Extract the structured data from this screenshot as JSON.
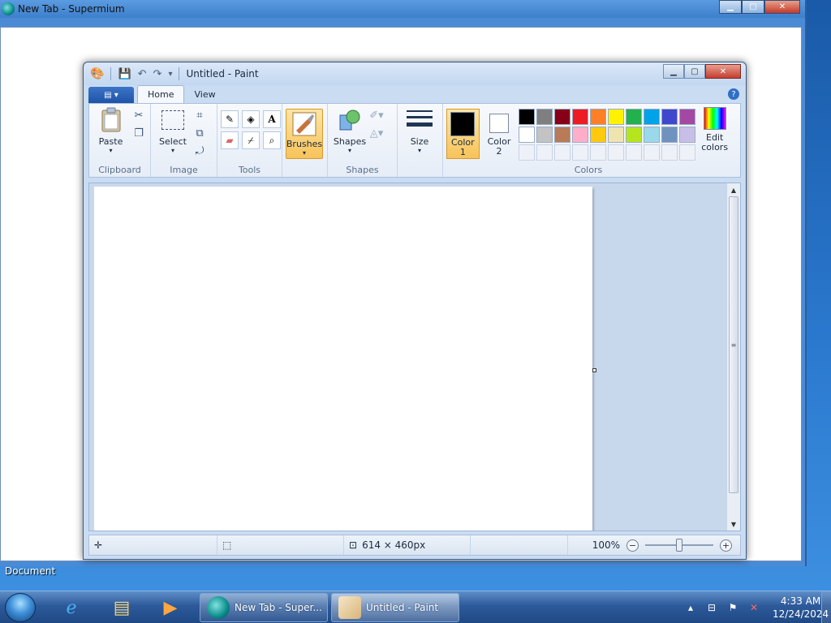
{
  "browser": {
    "title": "New Tab - Supermium"
  },
  "paint": {
    "title": "Untitled - Paint",
    "tabs": [
      {
        "label": "Home",
        "active": true
      },
      {
        "label": "View",
        "active": false
      }
    ],
    "groups": {
      "clipboard": {
        "label": "Clipboard",
        "paste": "Paste"
      },
      "image": {
        "label": "Image",
        "select": "Select"
      },
      "tools": {
        "label": "Tools"
      },
      "brushes": {
        "label": "Brushes"
      },
      "shapes": {
        "label": "Shapes",
        "shapes": "Shapes"
      },
      "size": {
        "label": "Size"
      },
      "colors": {
        "label": "Colors",
        "color1": "Color\n1",
        "color2": "Color\n2",
        "edit": "Edit colors",
        "color1_value": "#000000",
        "color2_value": "#ffffff",
        "palette": [
          "#000000",
          "#7f7f7f",
          "#880015",
          "#ed1c24",
          "#ff7f27",
          "#fff200",
          "#22b14c",
          "#00a2e8",
          "#3f48cc",
          "#a349a4",
          "#ffffff",
          "#c3c3c3",
          "#b97a57",
          "#ffaec9",
          "#ffc90e",
          "#efe4b0",
          "#b5e61d",
          "#99d9ea",
          "#7092be",
          "#c8bfe7",
          "",
          "",
          "",
          "",
          "",
          "",
          "",
          "",
          "",
          ""
        ]
      }
    },
    "status": {
      "canvas_size": "614 × 460px",
      "zoom": "100%"
    }
  },
  "desktop": {
    "doc_label": "Document"
  },
  "taskbar": {
    "tasks": [
      {
        "label": "New Tab - Super..."
      },
      {
        "label": "Untitled - Paint"
      }
    ],
    "time": "4:33 AM",
    "date": "12/24/2024"
  }
}
